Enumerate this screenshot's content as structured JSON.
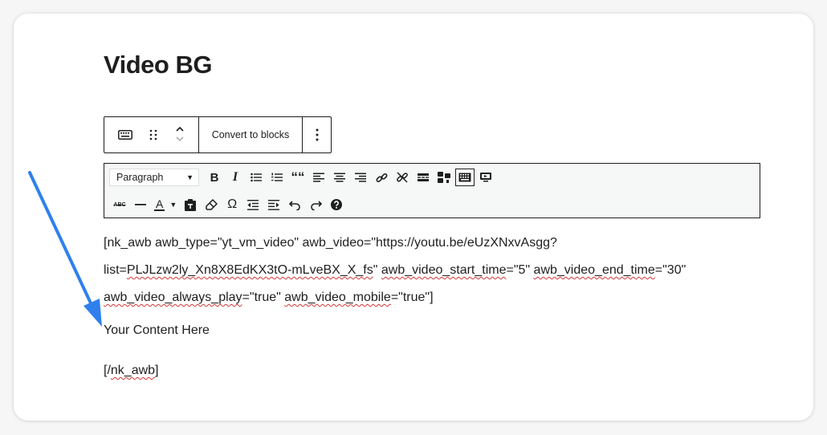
{
  "page": {
    "title": "Video BG"
  },
  "block_toolbar": {
    "convert_label": "Convert to blocks",
    "icons": [
      "keyboard-icon",
      "drag-handle-icon",
      "move-up-icon",
      "move-down-icon",
      "more-options-icon"
    ]
  },
  "classic_toolbar": {
    "format_select_value": "Paragraph",
    "row1_icons": [
      "bold-icon",
      "italic-icon",
      "bullet-list-icon",
      "numbered-list-icon",
      "blockquote-icon",
      "align-left-icon",
      "align-center-icon",
      "align-right-icon",
      "link-icon",
      "unlink-icon",
      "read-more-icon",
      "toolbar-toggle-icon",
      "keyboard-shortcuts-icon",
      "embed-icon"
    ],
    "row2_icons": [
      "strikethrough-icon",
      "horizontal-line-icon",
      "text-color-icon",
      "paste-as-text-icon",
      "clear-formatting-icon",
      "special-character-icon",
      "outdent-icon",
      "indent-icon",
      "undo-icon",
      "redo-icon",
      "help-icon"
    ],
    "bold_glyph": "B",
    "italic_glyph": "I",
    "quote_glyph": "““",
    "omega_glyph": "Ω",
    "text_color_glyph": "A",
    "strike_glyph": "ABC"
  },
  "content": {
    "shortcode_line1": "[nk_awb awb_type=\"yt_vm_video\" awb_video=\"https://youtu.be/eUzXNxvAsgg?",
    "line2_prefix": "list=",
    "line2_spell1": "PLJLzw2ly_Xn8X8EdKX3tO-mLveBX_X_fs",
    "line2_mid1": "\" ",
    "line2_spell2": "awb_video_start_time",
    "line2_mid2": "=\"5\" ",
    "line2_spell3": "awb_video_end_time",
    "line2_suffix": "=\"30\"",
    "line3_spell1": "awb_video_always_play",
    "line3_mid": "=\"true\" ",
    "line3_spell2": "awb_video_mobile",
    "line3_suffix": "=\"true\"]",
    "your_content": "Your Content Here",
    "closing_prefix": "[/",
    "closing_spell": "nk_awb",
    "closing_suffix": "]"
  },
  "colors": {
    "annotation_arrow": "#2f80ed",
    "spellcheck": "#d63638"
  }
}
